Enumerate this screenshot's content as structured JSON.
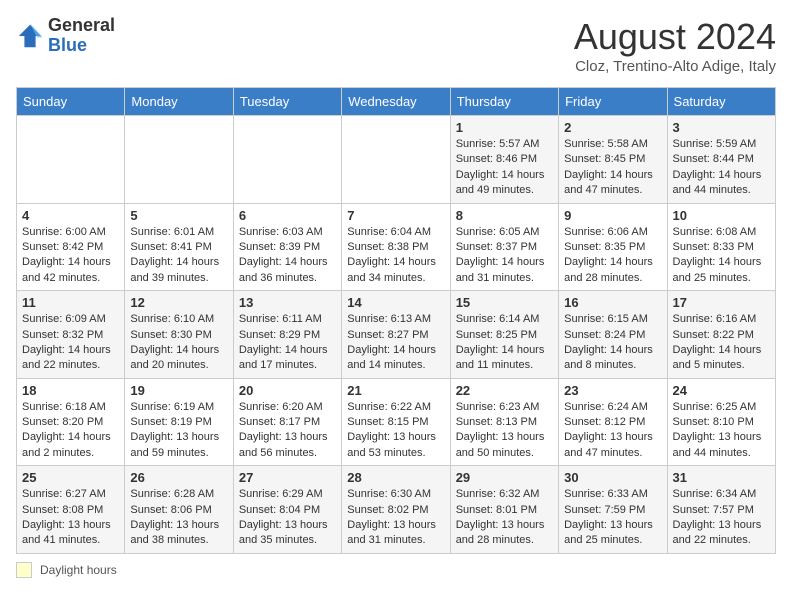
{
  "header": {
    "logo_general": "General",
    "logo_blue": "Blue",
    "month_title": "August 2024",
    "subtitle": "Cloz, Trentino-Alto Adige, Italy"
  },
  "days_of_week": [
    "Sunday",
    "Monday",
    "Tuesday",
    "Wednesday",
    "Thursday",
    "Friday",
    "Saturday"
  ],
  "legend_label": "Daylight hours",
  "weeks": [
    [
      {
        "day": "",
        "info": ""
      },
      {
        "day": "",
        "info": ""
      },
      {
        "day": "",
        "info": ""
      },
      {
        "day": "",
        "info": ""
      },
      {
        "day": "1",
        "info": "Sunrise: 5:57 AM\nSunset: 8:46 PM\nDaylight: 14 hours and 49 minutes."
      },
      {
        "day": "2",
        "info": "Sunrise: 5:58 AM\nSunset: 8:45 PM\nDaylight: 14 hours and 47 minutes."
      },
      {
        "day": "3",
        "info": "Sunrise: 5:59 AM\nSunset: 8:44 PM\nDaylight: 14 hours and 44 minutes."
      }
    ],
    [
      {
        "day": "4",
        "info": "Sunrise: 6:00 AM\nSunset: 8:42 PM\nDaylight: 14 hours and 42 minutes."
      },
      {
        "day": "5",
        "info": "Sunrise: 6:01 AM\nSunset: 8:41 PM\nDaylight: 14 hours and 39 minutes."
      },
      {
        "day": "6",
        "info": "Sunrise: 6:03 AM\nSunset: 8:39 PM\nDaylight: 14 hours and 36 minutes."
      },
      {
        "day": "7",
        "info": "Sunrise: 6:04 AM\nSunset: 8:38 PM\nDaylight: 14 hours and 34 minutes."
      },
      {
        "day": "8",
        "info": "Sunrise: 6:05 AM\nSunset: 8:37 PM\nDaylight: 14 hours and 31 minutes."
      },
      {
        "day": "9",
        "info": "Sunrise: 6:06 AM\nSunset: 8:35 PM\nDaylight: 14 hours and 28 minutes."
      },
      {
        "day": "10",
        "info": "Sunrise: 6:08 AM\nSunset: 8:33 PM\nDaylight: 14 hours and 25 minutes."
      }
    ],
    [
      {
        "day": "11",
        "info": "Sunrise: 6:09 AM\nSunset: 8:32 PM\nDaylight: 14 hours and 22 minutes."
      },
      {
        "day": "12",
        "info": "Sunrise: 6:10 AM\nSunset: 8:30 PM\nDaylight: 14 hours and 20 minutes."
      },
      {
        "day": "13",
        "info": "Sunrise: 6:11 AM\nSunset: 8:29 PM\nDaylight: 14 hours and 17 minutes."
      },
      {
        "day": "14",
        "info": "Sunrise: 6:13 AM\nSunset: 8:27 PM\nDaylight: 14 hours and 14 minutes."
      },
      {
        "day": "15",
        "info": "Sunrise: 6:14 AM\nSunset: 8:25 PM\nDaylight: 14 hours and 11 minutes."
      },
      {
        "day": "16",
        "info": "Sunrise: 6:15 AM\nSunset: 8:24 PM\nDaylight: 14 hours and 8 minutes."
      },
      {
        "day": "17",
        "info": "Sunrise: 6:16 AM\nSunset: 8:22 PM\nDaylight: 14 hours and 5 minutes."
      }
    ],
    [
      {
        "day": "18",
        "info": "Sunrise: 6:18 AM\nSunset: 8:20 PM\nDaylight: 14 hours and 2 minutes."
      },
      {
        "day": "19",
        "info": "Sunrise: 6:19 AM\nSunset: 8:19 PM\nDaylight: 13 hours and 59 minutes."
      },
      {
        "day": "20",
        "info": "Sunrise: 6:20 AM\nSunset: 8:17 PM\nDaylight: 13 hours and 56 minutes."
      },
      {
        "day": "21",
        "info": "Sunrise: 6:22 AM\nSunset: 8:15 PM\nDaylight: 13 hours and 53 minutes."
      },
      {
        "day": "22",
        "info": "Sunrise: 6:23 AM\nSunset: 8:13 PM\nDaylight: 13 hours and 50 minutes."
      },
      {
        "day": "23",
        "info": "Sunrise: 6:24 AM\nSunset: 8:12 PM\nDaylight: 13 hours and 47 minutes."
      },
      {
        "day": "24",
        "info": "Sunrise: 6:25 AM\nSunset: 8:10 PM\nDaylight: 13 hours and 44 minutes."
      }
    ],
    [
      {
        "day": "25",
        "info": "Sunrise: 6:27 AM\nSunset: 8:08 PM\nDaylight: 13 hours and 41 minutes."
      },
      {
        "day": "26",
        "info": "Sunrise: 6:28 AM\nSunset: 8:06 PM\nDaylight: 13 hours and 38 minutes."
      },
      {
        "day": "27",
        "info": "Sunrise: 6:29 AM\nSunset: 8:04 PM\nDaylight: 13 hours and 35 minutes."
      },
      {
        "day": "28",
        "info": "Sunrise: 6:30 AM\nSunset: 8:02 PM\nDaylight: 13 hours and 31 minutes."
      },
      {
        "day": "29",
        "info": "Sunrise: 6:32 AM\nSunset: 8:01 PM\nDaylight: 13 hours and 28 minutes."
      },
      {
        "day": "30",
        "info": "Sunrise: 6:33 AM\nSunset: 7:59 PM\nDaylight: 13 hours and 25 minutes."
      },
      {
        "day": "31",
        "info": "Sunrise: 6:34 AM\nSunset: 7:57 PM\nDaylight: 13 hours and 22 minutes."
      }
    ]
  ]
}
